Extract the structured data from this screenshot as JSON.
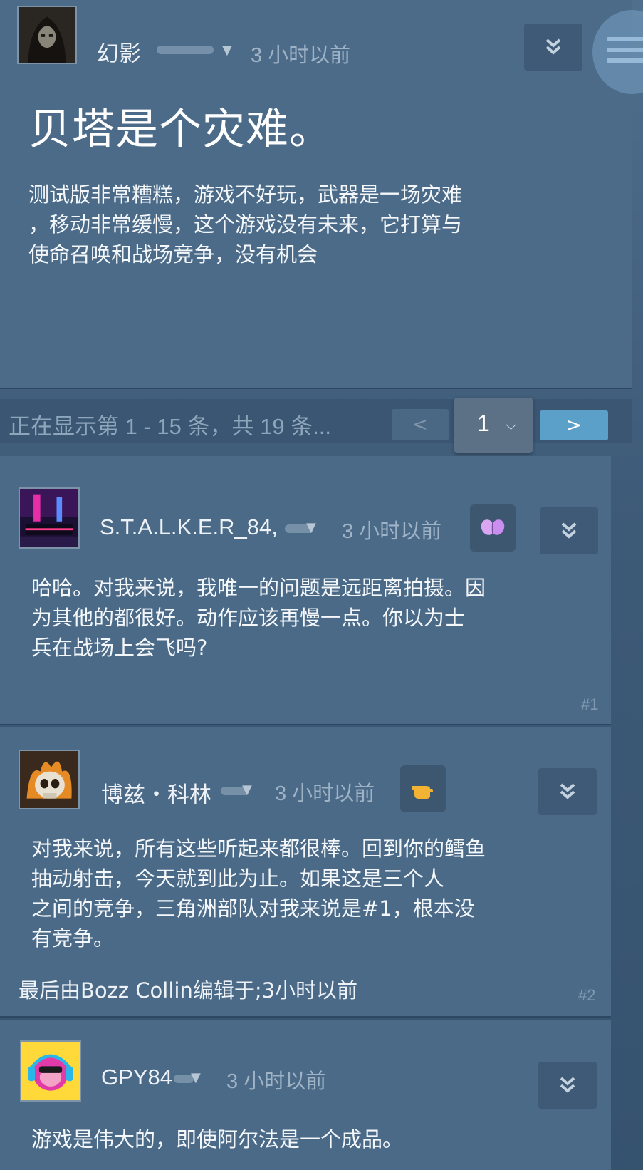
{
  "op": {
    "username": "幻影",
    "time": "3 小时以前",
    "title": "贝塔是个灾难。",
    "body": "测试版非常糟糕，游戏不好玩，武器是一场灾难\n，移动非常缓慢，这个游戏没有未来，它打算与\n使命召唤和战场竞争，没有机会"
  },
  "pagination": {
    "summary": "正在显示第 1 - 15 条，共 19 条...",
    "prev_label": "<",
    "current_page": "1",
    "next_label": ">"
  },
  "comments": [
    {
      "username": "S.T.A.L.K.E.R_84,",
      "time": "3 小时以前",
      "body": "哈哈。对我来说，我唯一的问题是远距离拍摄。因\n为其他的都很好。动作应该再慢一点。你以为士\n兵在战场上会飞吗?",
      "number": "#1",
      "reaction_icon": "butterfly-reaction-icon"
    },
    {
      "username": "博兹・科林",
      "time": "3 小时以前",
      "body": "对我来说，所有这些听起来都很棒。回到你的鳕鱼\n抽动射击，今天就到此为止。如果这是三个人\n之间的竞争，三角洲部队对我来说是#1，根本没\n有竞争。",
      "edited_note": "最后由Bozz Collin编辑于;3小时以前",
      "number": "#2",
      "reaction_icon": "pointing-hand-reaction-icon"
    },
    {
      "username": "GPY84",
      "time": "3 小时以前",
      "body": "游戏是伟大的，即使阿尔法是一个成品。"
    }
  ],
  "colors": {
    "background": "#4a6a88",
    "accent_next": "#5aa0c8",
    "muted_text": "#9fb3c6"
  }
}
